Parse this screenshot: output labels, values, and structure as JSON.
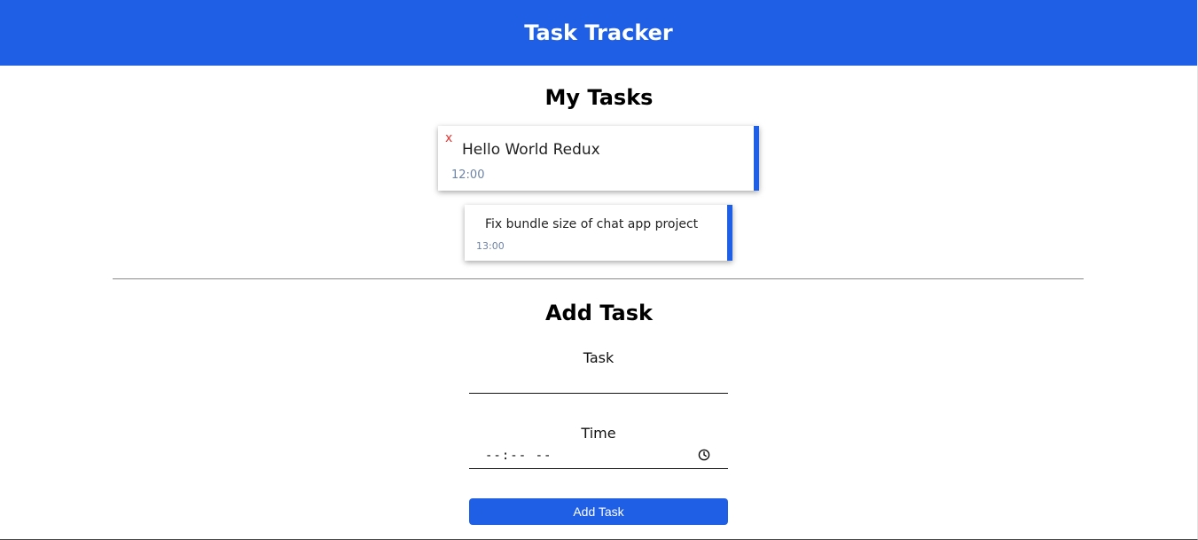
{
  "header": {
    "title": "Task Tracker",
    "color": "#1f5fe6"
  },
  "tasks_section": {
    "title": "My Tasks",
    "delete_label": "x",
    "tasks": [
      {
        "text": "Hello World Redux",
        "time": "12:00"
      },
      {
        "text": "Fix bundle size of chat app project",
        "time": "13:00"
      }
    ]
  },
  "add_section": {
    "title": "Add Task",
    "task_label": "Task",
    "task_value": "",
    "time_label": "Time",
    "time_placeholder": "--:-- --",
    "time_icon": "clock-icon",
    "submit_label": "Add Task"
  }
}
